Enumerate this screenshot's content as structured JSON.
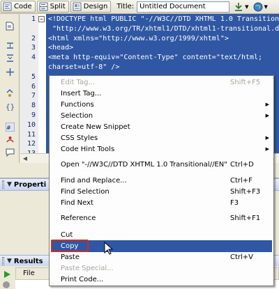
{
  "toolbar": {
    "code_label": "Code",
    "split_label": "Split",
    "design_label": "Design",
    "title_label": "Title:",
    "title_value": "Untitled Document"
  },
  "code": {
    "lines": [
      {
        "number": "1",
        "text": "<!DOCTYPE html PUBLIC \"-//W3C//DTD XHTML 1.0 Transition"
      },
      {
        "number": "",
        "text": " \"http://www.w3.org/TR/xhtml1/DTD/xhtml1-transitional.d"
      },
      {
        "number": "2",
        "text": "<html xmlns=\"http://www.w3.org/1999/xhtml\">"
      },
      {
        "number": "3",
        "text": "<head>"
      },
      {
        "number": "4",
        "text": "<meta http-equiv=\"Content-Type\" content=\"text/html;"
      },
      {
        "number": "",
        "text": "charset=utf-8\" />"
      },
      {
        "number": "5",
        "text": ""
      },
      {
        "number": "6",
        "text": ""
      },
      {
        "number": "7",
        "text": ""
      },
      {
        "number": "8",
        "text": ""
      },
      {
        "number": "9",
        "text": ""
      },
      {
        "number": "10",
        "text": ""
      },
      {
        "number": "11",
        "text": ""
      },
      {
        "number": "12",
        "text": ""
      },
      {
        "number": "13",
        "text": ""
      }
    ]
  },
  "panels": {
    "properties_label": "Properti",
    "results_label": "Results",
    "file_column": "File"
  },
  "menu": {
    "items": [
      {
        "label": "Edit Tag...",
        "shortcut": "Shift+F5",
        "disabled": true
      },
      {
        "label": "Insert Tag...",
        "shortcut": ""
      },
      {
        "label": "Functions",
        "submenu": true
      },
      {
        "label": "Selection",
        "submenu": true
      },
      {
        "label": "Create New Snippet",
        "shortcut": ""
      },
      {
        "label": "CSS Styles",
        "submenu": true
      },
      {
        "label": "Code Hint Tools",
        "submenu": true
      },
      {
        "label": "Open \"-//W3C//DTD XHTML 1.0 Transitional//EN\"",
        "shortcut": "Ctrl+D"
      },
      {
        "label": "Find and Replace...",
        "shortcut": "Ctrl+F"
      },
      {
        "label": "Find Selection",
        "shortcut": "Shift+F3"
      },
      {
        "label": "Find Next",
        "shortcut": "F3"
      },
      {
        "label": "Reference",
        "shortcut": "Shift+F1"
      },
      {
        "label": "Cut",
        "shortcut": ""
      },
      {
        "label": "Copy",
        "shortcut": "",
        "highlighted": true
      },
      {
        "label": "Paste",
        "shortcut": "Ctrl+V"
      },
      {
        "label": "Paste Special...",
        "shortcut": "",
        "disabled": true
      },
      {
        "label": "Print Code...",
        "shortcut": ""
      }
    ]
  },
  "colors": {
    "selection": "#2f57a3",
    "highlight_box": "#d52b1e"
  }
}
